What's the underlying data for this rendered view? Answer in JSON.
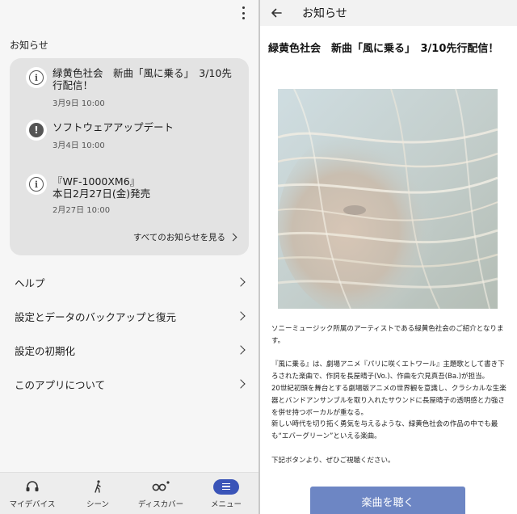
{
  "left": {
    "section_title": "お知らせ",
    "news": [
      {
        "title": "緑黄色社会　新曲「風に乗る」　3/10先行配信！",
        "date": "3月9日 10:00",
        "icon": "info-icon"
      },
      {
        "title": "ソフトウェアアップデート",
        "date": "3月4日 10:00",
        "icon": "alert-icon"
      },
      {
        "title_line1": "『WF-1000XM6』",
        "title_line2": "本日2月27日(金)発売",
        "date": "2月27日 10:00",
        "icon": "info-icon"
      }
    ],
    "see_all": "すべてのお知らせを見る",
    "menu": [
      "ヘルプ",
      "設定とデータのバックアップと復元",
      "設定の初期化",
      "このアプリについて"
    ],
    "nav": [
      "マイデバイス",
      "シーン",
      "ディスカバー",
      "メニュー"
    ],
    "nav_active": "メニュー"
  },
  "right": {
    "header_title": "お知らせ",
    "title": "緑黄色社会　新曲「風に乗る」　3/10先行配信！",
    "body": [
      "ソニーミュージック所属のアーティストである緑黄色社会のご紹介となります。",
      "",
      "『風に乗る』は、劇場アニメ『パリに咲くエトワール』主題歌として書き下ろされた楽曲で、作詞を長屋晴子(Vo.)、作曲を穴見真吾(Ba.)が担当。",
      "20世紀初頭を舞台とする劇場版アニメの世界観を意識し、クラシカルな生楽器とバンドアンサンブルを取り入れたサウンドに長屋晴子の透明感と力強さを併せ持つボーカルが重なる。",
      "新しい時代を切り拓く勇気を与えるような、緑黄色社会の作品の中でも最も“エバーグリーン”といえる楽曲。",
      "",
      "下記ボタンより、ぜひご視聴ください。"
    ],
    "button_label": "楽曲を聴く"
  },
  "colors": {
    "accent": "#3a54b8",
    "button": "#6d86c4",
    "card": "#e3e3e3"
  }
}
